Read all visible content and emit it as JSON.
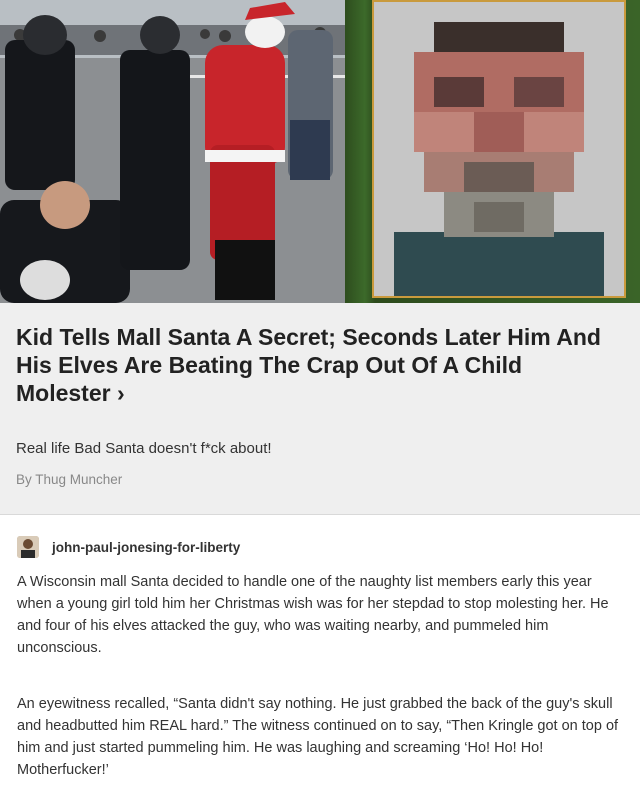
{
  "article": {
    "title": "Kid Tells Mall Santa A Secret; Seconds Later Him And His Elves Are Beating The Crap Out Of A Child Molester",
    "title_chevron": "›",
    "subtitle": "Real life Bad Santa doesn't f*ck about!",
    "byline": "By Thug Muncher"
  },
  "post": {
    "username": "john-paul-jonesing-for-liberty",
    "paragraphs": [
      "A Wisconsin mall Santa decided to handle one of the naughty list members early this year when a young girl told him her Christmas wish was for her stepdad to stop molesting her. He and four of his elves attacked the guy, who was waiting nearby, and pummeled him unconscious.",
      "An eyewitness recalled, “Santa didn't say nothing. He just grabbed the back of the guy's skull and headbutted him REAL hard.” The witness continued on to say, “Then Kringle got on top of him and just started pummeling him. He was laughing and screaming ‘Ho! Ho! Ho! Motherfucker!’"
    ]
  },
  "colors": {
    "title": "#222222",
    "card_bg": "#efefef",
    "byline": "#888888",
    "santa_red": "#c8252b"
  }
}
